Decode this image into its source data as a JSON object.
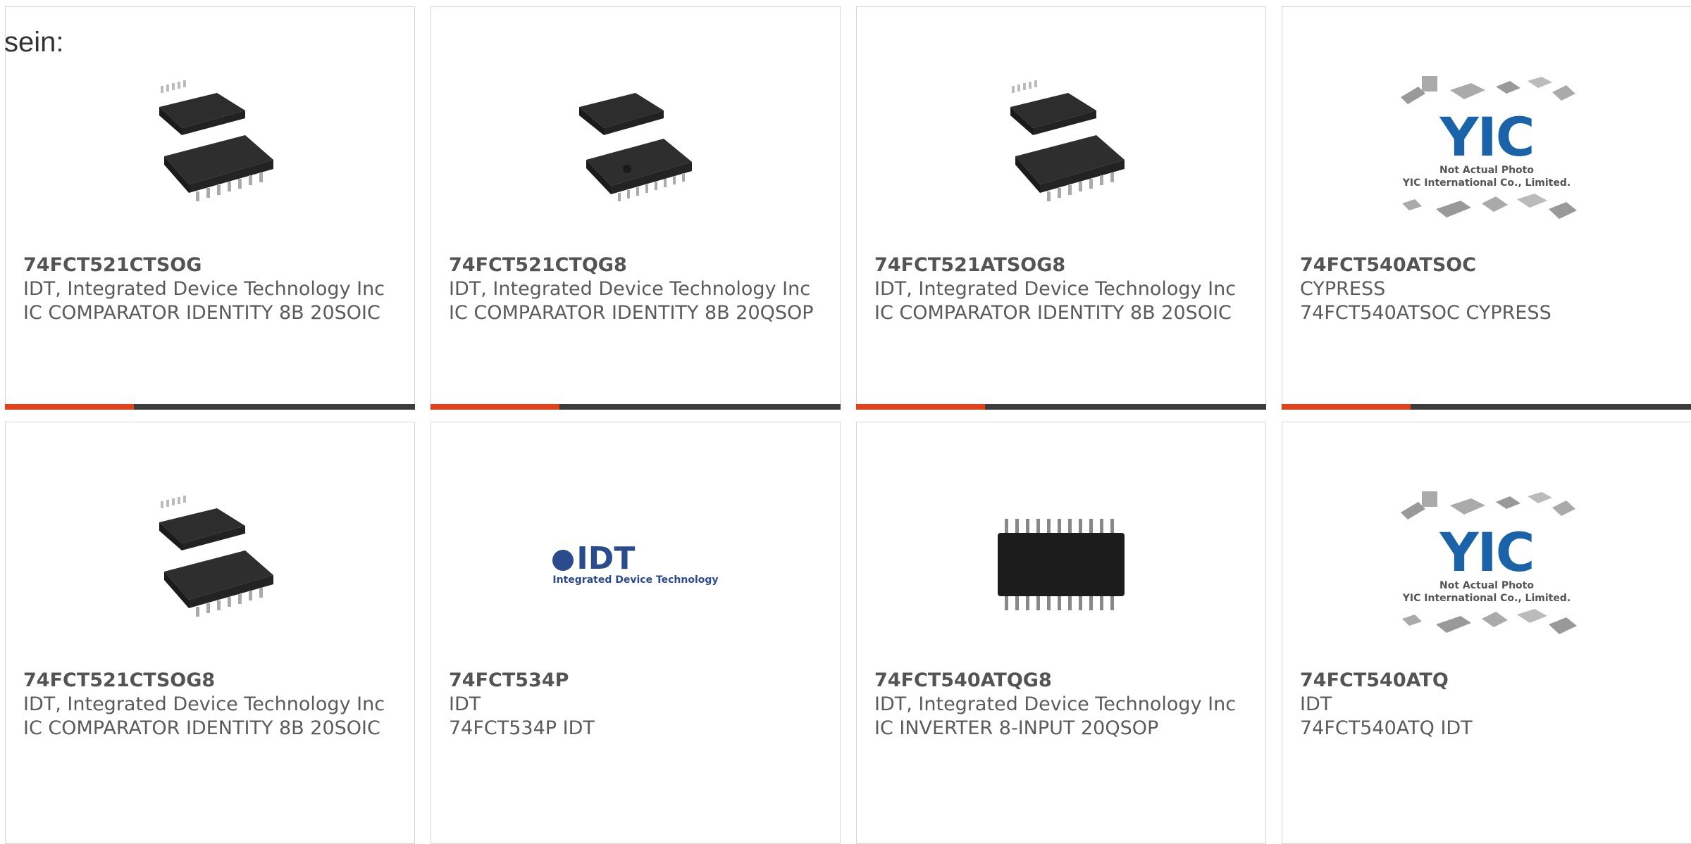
{
  "lead_text": "sein:",
  "colors": {
    "accent": "#e2421a",
    "bar": "#3c3c3c",
    "border": "#d6d6d6",
    "text": "#5b5b5b"
  },
  "products": [
    {
      "part": "74FCT521CTSOG",
      "manufacturer": "IDT, Integrated Device Technology Inc",
      "description": "IC COMPARATOR IDENTITY 8B 20SOIC",
      "image": "soic-chip-pair-icon"
    },
    {
      "part": "74FCT521CTQG8",
      "manufacturer": "IDT, Integrated Device Technology Inc",
      "description": "IC COMPARATOR IDENTITY 8B 20QSOP",
      "image": "qsop-chip-pair-icon"
    },
    {
      "part": "74FCT521ATSOG8",
      "manufacturer": "IDT, Integrated Device Technology Inc",
      "description": "IC COMPARATOR IDENTITY 8B 20SOIC",
      "image": "soic-chip-pair-icon"
    },
    {
      "part": "74FCT540ATSOC",
      "manufacturer": "CYPRESS",
      "description": "74FCT540ATSOC CYPRESS",
      "image": "yic-placeholder",
      "placeholder_logo": "YIC",
      "placeholder_caption_1": "Not Actual Photo",
      "placeholder_caption_2": "YIC International Co., Limited."
    },
    {
      "part": "74FCT521CTSOG8",
      "manufacturer": "IDT, Integrated Device Technology Inc",
      "description": "IC COMPARATOR IDENTITY 8B 20SOIC",
      "image": "soic-chip-pair-icon"
    },
    {
      "part": "74FCT534P",
      "manufacturer": "IDT",
      "description": "74FCT534P IDT",
      "image": "idt-logo",
      "logo_text": "IDT",
      "logo_sub": "Integrated Device Technology"
    },
    {
      "part": "74FCT540ATQG8",
      "manufacturer": "IDT, Integrated Device Technology Inc",
      "description": "IC INVERTER 8-INPUT 20QSOP",
      "image": "qsop-chip-photo-icon"
    },
    {
      "part": "74FCT540ATQ",
      "manufacturer": "IDT",
      "description": "74FCT540ATQ IDT",
      "image": "yic-placeholder",
      "placeholder_logo": "YIC",
      "placeholder_caption_1": "Not Actual Photo",
      "placeholder_caption_2": "YIC International Co., Limited."
    }
  ]
}
